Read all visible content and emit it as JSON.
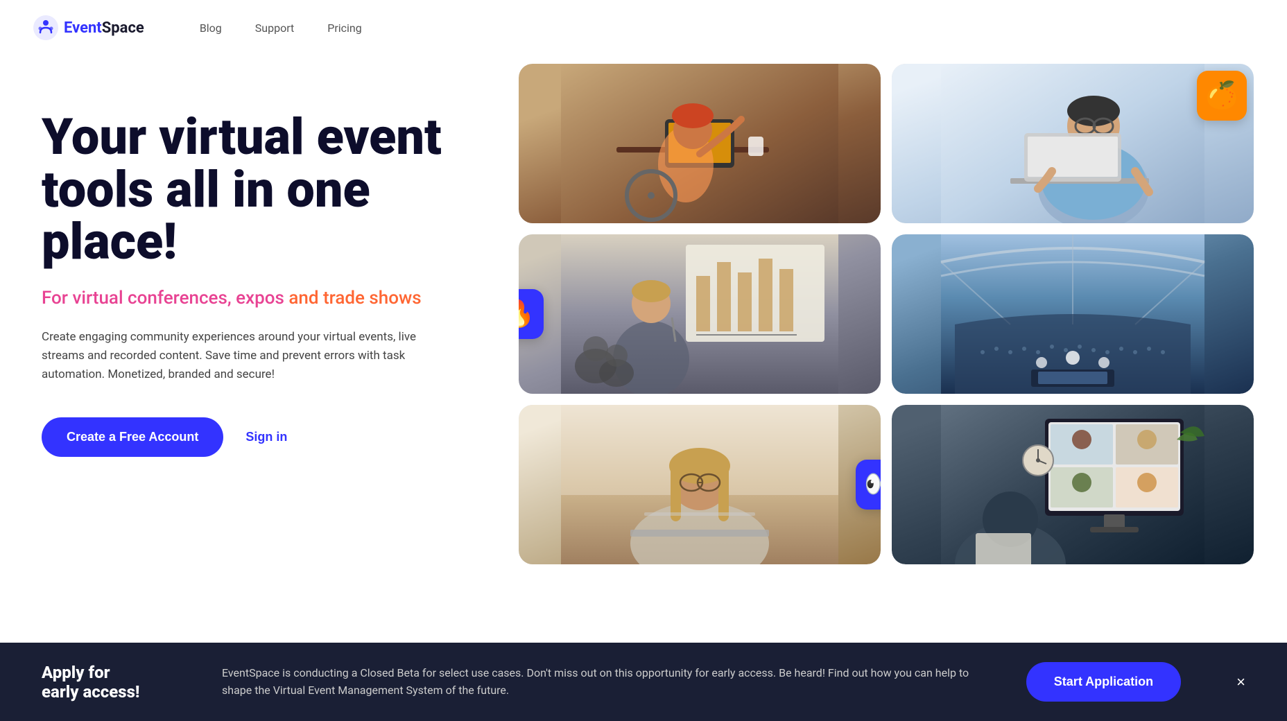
{
  "header": {
    "logo_text_event": "Event",
    "logo_text_space": "Space",
    "nav": {
      "blog": "Blog",
      "support": "Support",
      "pricing": "Pricing"
    }
  },
  "hero": {
    "heading": "Your virtual event tools all in one place!",
    "subheading_part1": "For virtual conferences, expos",
    "subheading_part2": " and trade shows",
    "description": "Create engaging community experiences around your virtual events, live streams and recorded content. Save time and prevent errors with task automation. Monetized, branded and secure!",
    "cta_primary": "Create a Free Account",
    "cta_secondary": "Sign in"
  },
  "images": {
    "row1": [
      {
        "alt": "Person in wheelchair working with laptop",
        "label": ""
      },
      {
        "alt": "Man working on laptop",
        "label": ""
      }
    ],
    "row2": [
      {
        "alt": "Woman presenting at conference",
        "label": ""
      },
      {
        "alt": "Stadium arena event",
        "label": ""
      }
    ],
    "row3": [
      {
        "alt": "Woman working on laptop",
        "label": ""
      },
      {
        "alt": "Team video call",
        "label": ""
      }
    ]
  },
  "badges": {
    "fire": "🔥",
    "eyes": "👀",
    "orange_leaf": "🍊"
  },
  "banner": {
    "title": "Apply for\nearly access!",
    "description": "EventSpace is conducting a Closed Beta for select use cases. Don't miss out on this opportunity for early access. Be heard! Find out how you can help to shape the Virtual Event Management System of the future.",
    "cta": "Start Application",
    "close": "×"
  },
  "colors": {
    "primary_blue": "#3333ff",
    "accent_pink": "#e84393",
    "accent_orange": "#ff6633",
    "dark_navy": "#1a1f35",
    "text_dark": "#0d0d2b"
  }
}
